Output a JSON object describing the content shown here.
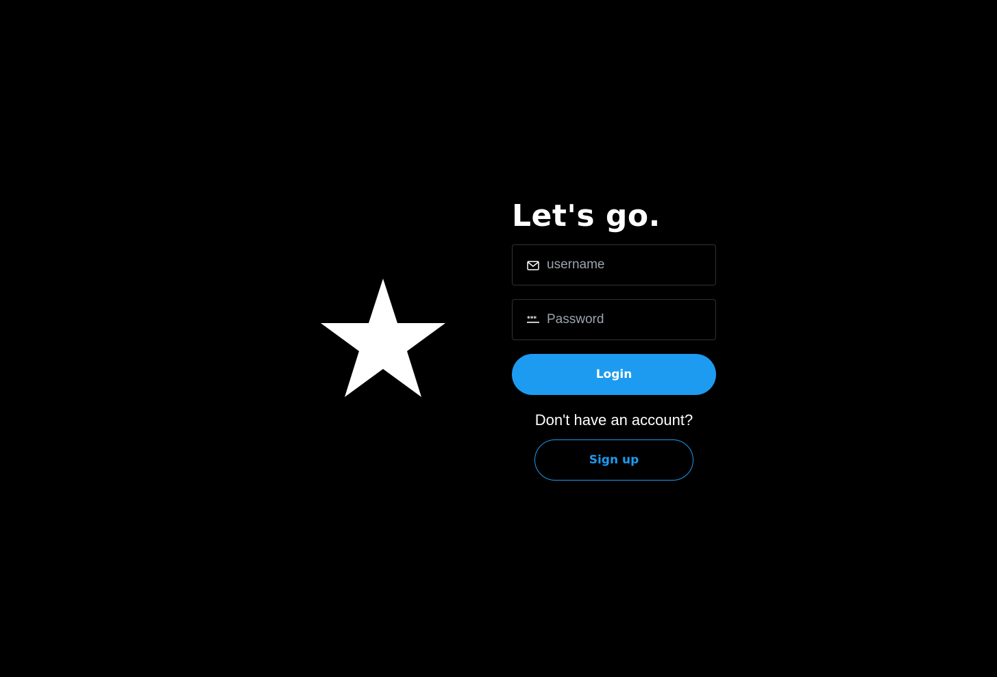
{
  "logo": {
    "icon": "star-icon",
    "color": "#ffffff"
  },
  "login_form": {
    "title": "Let's go.",
    "username": {
      "icon": "mail-icon",
      "placeholder": "username",
      "value": ""
    },
    "password": {
      "icon": "password-dots-icon",
      "placeholder": "Password",
      "value": ""
    },
    "login_label": "Login",
    "signup_prompt": "Don't have an account?",
    "signup_label": "Sign up"
  },
  "colors": {
    "background": "#000000",
    "accent": "#1d9bf0",
    "field_border": "#2f3336",
    "placeholder": "#9ca3af"
  }
}
